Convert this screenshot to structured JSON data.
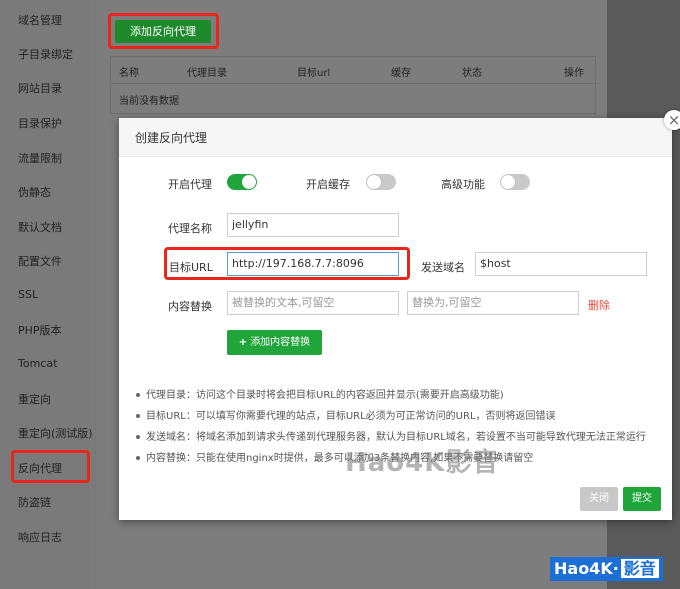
{
  "sidebar": {
    "items": [
      {
        "label": "域名管理"
      },
      {
        "label": "子目录绑定"
      },
      {
        "label": "网站目录"
      },
      {
        "label": "目录保护"
      },
      {
        "label": "流量限制"
      },
      {
        "label": "伪静态"
      },
      {
        "label": "默认文档"
      },
      {
        "label": "配置文件"
      },
      {
        "label": "SSL"
      },
      {
        "label": "PHP版本"
      },
      {
        "label": "Tomcat"
      },
      {
        "label": "重定向"
      },
      {
        "label": "重定向(测试版)"
      },
      {
        "label": "反向代理",
        "selected": true
      },
      {
        "label": "防盗链"
      },
      {
        "label": "响应日志"
      }
    ]
  },
  "main": {
    "add_button": "添加反向代理",
    "table": {
      "headers": [
        "名称",
        "代理目录",
        "目标url",
        "缓存",
        "状态",
        "操作"
      ],
      "empty_text": "当前没有数据"
    }
  },
  "modal": {
    "title": "创建反向代理",
    "toggles": [
      {
        "label": "开启代理",
        "on": true
      },
      {
        "label": "开启缓存",
        "on": false
      },
      {
        "label": "高级功能",
        "on": false
      }
    ],
    "proxy_name_label": "代理名称",
    "proxy_name_value": "jellyfin",
    "target_url_label": "目标URL",
    "target_url_value": "http://197.168.7.7:8096",
    "send_domain_label": "发送域名",
    "send_domain_value": "$host",
    "content_replace_label": "内容替换",
    "replace_from_placeholder": "被替换的文本,可留空",
    "replace_to_placeholder": "替换为,可留空",
    "delete_label": "删除",
    "add_content_label": "添加内容替换",
    "tips": [
      "代理目录：访问这个目录时将会把目标URL的内容返回并显示(需要开启高级功能)",
      "目标URL：可以填写你需要代理的站点，目标URL必须为可正常访问的URL，否则将返回错误",
      "发送域名：将域名添加到请求头传递到代理服务器，默认为目标URL域名，若设置不当可能导致代理无法正常运行",
      "内容替换：只能在使用nginx时提供，最多可以添加3条替换内容,如果不需要替换请留空"
    ],
    "close_button": "关闭",
    "submit_button": "提交"
  },
  "watermark": "Hao4K影音",
  "badge": {
    "main": "Hao4K·",
    "sub": "影音"
  },
  "colors": {
    "accent": "#20a53a",
    "highlight": "#e8261c",
    "danger": "#e84b3c"
  }
}
